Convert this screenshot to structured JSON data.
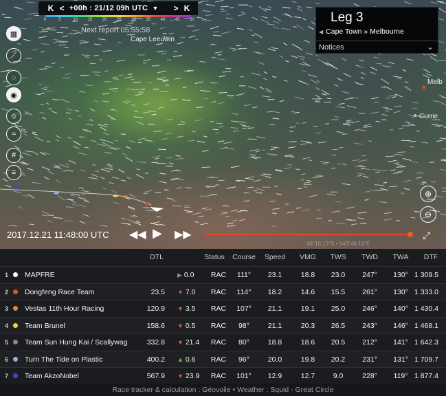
{
  "timebar": {
    "first_label": "K",
    "prev_label": "<",
    "time": "+00h : 21/12 09h UTC",
    "dropdown": "▼",
    "next_label": ">",
    "last_label": "K",
    "scale": [
      "0",
      "5",
      "10",
      "15",
      "20",
      "25",
      "30",
      "35",
      "40",
      "45",
      "50"
    ]
  },
  "next_report": "Next report 05:55:58",
  "places": {
    "cape_leeuwin": "Cape Leeuwin",
    "melbourne": "Melb",
    "currie": "Currie"
  },
  "leg": {
    "title": "Leg 3",
    "route": "Cape Town » Melbourne",
    "notices": "Notices"
  },
  "playback": {
    "datetime": "2017.12.21 11:48:00 UTC",
    "coords": "46°10.13\"S • 143°46.19\"E"
  },
  "table": {
    "headers": {
      "dtl": "DTL",
      "status": "Status",
      "course": "Course",
      "speed": "Speed",
      "vmg": "VMG",
      "tws": "TWS",
      "twd": "TWD",
      "twa": "TWA",
      "dtf": "DTF"
    },
    "rows": [
      {
        "rank": "1",
        "color": "#ffffff",
        "team": "MAPFRE",
        "dtl": "",
        "change": "0.0",
        "trend": "flat",
        "status": "RAC",
        "course": "111°",
        "speed": "23.1",
        "vmg": "18.8",
        "tws": "23.0",
        "twd": "247°",
        "twa": "130°",
        "dtf": "1 309.5"
      },
      {
        "rank": "2",
        "color": "#e0503a",
        "team": "Dongfeng Race Team",
        "dtl": "23.5",
        "change": "7.0",
        "trend": "down",
        "status": "RAC",
        "course": "114°",
        "speed": "18.2",
        "vmg": "14.6",
        "tws": "15.5",
        "twd": "261°",
        "twa": "130°",
        "dtf": "1 333.0"
      },
      {
        "rank": "3",
        "color": "#e08a3a",
        "team": "Vestas 11th Hour Racing",
        "dtl": "120.9",
        "change": "3.5",
        "trend": "down",
        "status": "RAC",
        "course": "107°",
        "speed": "21.1",
        "vmg": "19.1",
        "tws": "25.0",
        "twd": "246°",
        "twa": "140°",
        "dtf": "1 430.4"
      },
      {
        "rank": "4",
        "color": "#f2d43a",
        "team": "Team Brunel",
        "dtl": "158.6",
        "change": "0.5",
        "trend": "down",
        "status": "RAC",
        "course": "98°",
        "speed": "21.1",
        "vmg": "20.3",
        "tws": "26.5",
        "twd": "243°",
        "twa": "146°",
        "dtf": "1 468.1"
      },
      {
        "rank": "5",
        "color": "#8a8a8a",
        "team": "Team Sun Hung Kai / Scallywag",
        "dtl": "332.8",
        "change": "21.4",
        "trend": "down",
        "status": "RAC",
        "course": "80°",
        "speed": "18.8",
        "vmg": "18.6",
        "tws": "20.5",
        "twd": "212°",
        "twa": "141°",
        "dtf": "1 642.3"
      },
      {
        "rank": "6",
        "color": "#8fb0e0",
        "team": "Turn The Tide on Plastic",
        "dtl": "400.2",
        "change": "0.6",
        "trend": "up",
        "status": "RAC",
        "course": "96°",
        "speed": "20.0",
        "vmg": "19.8",
        "tws": "20.2",
        "twd": "231°",
        "twa": "131°",
        "dtf": "1 709.7"
      },
      {
        "rank": "7",
        "color": "#3a4ad0",
        "team": "Team AkzoNobel",
        "dtl": "567.9",
        "change": "23.9",
        "trend": "down",
        "status": "RAC",
        "course": "101°",
        "speed": "12.9",
        "vmg": "12.7",
        "tws": "9.0",
        "twd": "228°",
        "twa": "119°",
        "dtf": "1 877.4"
      }
    ]
  },
  "footer": "Race tracker & calculation : Géovoile • Weather : Squid - Great Circle"
}
